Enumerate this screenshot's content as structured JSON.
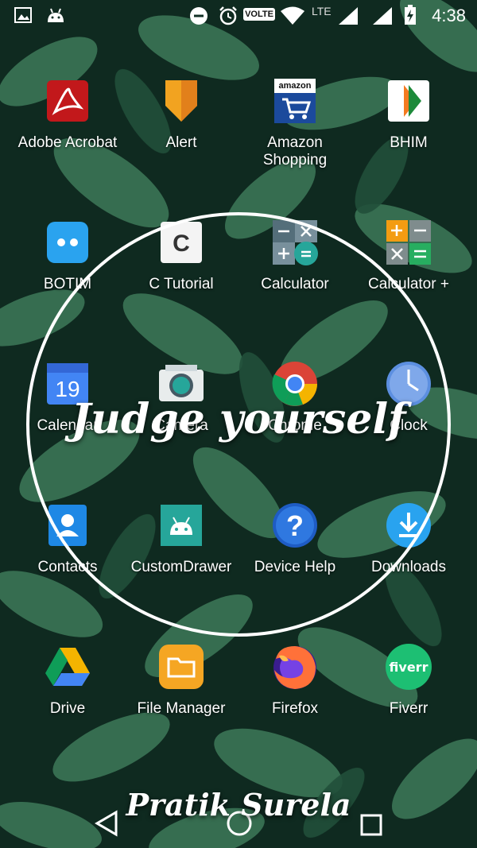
{
  "status_bar": {
    "time": "4:38",
    "volte_label": "VOLTE",
    "network_label": "LTE",
    "icons": [
      "gallery-icon",
      "android-icon",
      "dnd-icon",
      "alarm-icon",
      "wifi-icon",
      "signal-icon",
      "battery-charging-icon"
    ]
  },
  "apps": [
    {
      "label": "Adobe Acrobat",
      "icon": "adobe-acrobat-icon"
    },
    {
      "label": "Alert",
      "icon": "alert-icon"
    },
    {
      "label": "Amazon Shopping",
      "icon": "amazon-icon",
      "icon_text": "amazon"
    },
    {
      "label": "BHIM",
      "icon": "bhim-icon"
    },
    {
      "label": "BOTIM",
      "icon": "botim-icon"
    },
    {
      "label": "C Tutorial",
      "icon": "c-tutorial-icon",
      "icon_text": "C"
    },
    {
      "label": "Calculator",
      "icon": "calculator-icon"
    },
    {
      "label": "Calculator +",
      "icon": "calculator-plus-icon"
    },
    {
      "label": "Calendar",
      "icon": "calendar-icon",
      "icon_text": "19"
    },
    {
      "label": "Camera",
      "icon": "camera-icon"
    },
    {
      "label": "Chrome",
      "icon": "chrome-icon"
    },
    {
      "label": "Clock",
      "icon": "clock-icon"
    },
    {
      "label": "Contacts",
      "icon": "contacts-icon"
    },
    {
      "label": "CustomDrawer",
      "icon": "android-app-icon"
    },
    {
      "label": "Device Help",
      "icon": "device-help-icon",
      "icon_text": "?"
    },
    {
      "label": "Downloads",
      "icon": "downloads-icon"
    },
    {
      "label": "Drive",
      "icon": "drive-icon"
    },
    {
      "label": "File Manager",
      "icon": "file-manager-icon"
    },
    {
      "label": "Firefox",
      "icon": "firefox-icon"
    },
    {
      "label": "Fiverr",
      "icon": "fiverr-icon",
      "icon_text": "fiverr"
    }
  ],
  "overlay": {
    "text": "Judge yourself"
  },
  "watermark": {
    "text": "Pratik Surela"
  },
  "nav": {
    "icons": [
      "back-icon",
      "home-icon",
      "recents-icon"
    ]
  },
  "colors": {
    "leaf_dark": "#0f2a20",
    "leaf_green": "#3f7a5a",
    "ring": "#ffffff"
  }
}
